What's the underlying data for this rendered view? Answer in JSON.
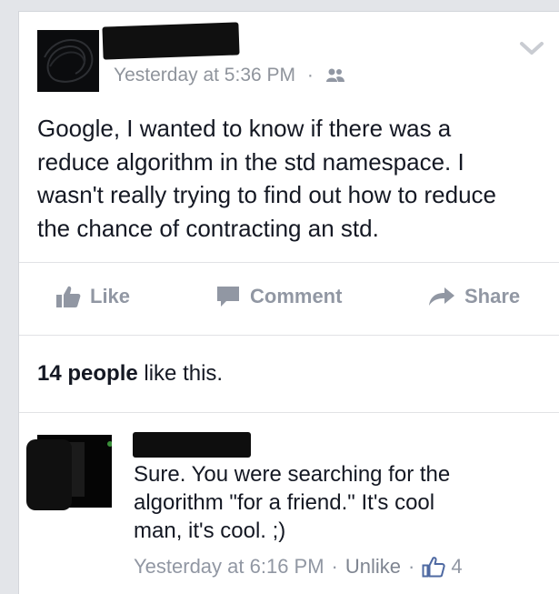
{
  "post": {
    "timestamp": "Yesterday at 5:36 PM",
    "separator": "·",
    "audience_icon": "friends-icon",
    "text": "Google, I wanted to know if there was a\nreduce algorithm in the std namespace. I\nwasn't really trying to find out how to reduce\nthe chance of contracting an std."
  },
  "actions": {
    "like_label": "Like",
    "comment_label": "Comment",
    "share_label": "Share"
  },
  "likes_summary": {
    "count_text": "14 people",
    "suffix": " like this."
  },
  "comment": {
    "text": "Sure. You were searching for the\nalgorithm \"for a friend.\" It's cool\nman, it's cool.  ;)",
    "timestamp": "Yesterday at 6:16 PM",
    "separator": "·",
    "unlike_label": "Unlike",
    "like_count": "4"
  },
  "colors": {
    "background": "#e3e5e9",
    "card": "#ffffff",
    "text": "#141823",
    "muted": "#9197a3",
    "link_blue": "#4e69a2"
  }
}
